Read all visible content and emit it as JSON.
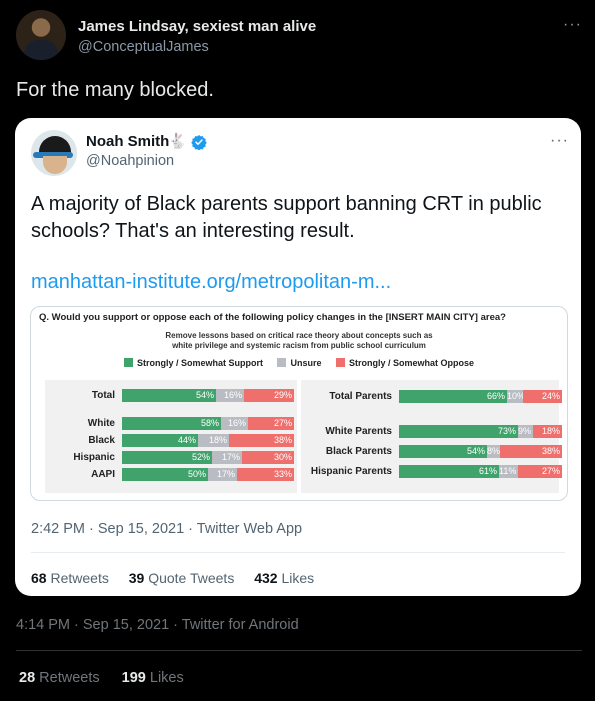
{
  "tweet": {
    "author_name": "James Lindsay, sexiest man alive",
    "author_handle": "@ConceptualJames",
    "more_icon": "more-dots-icon",
    "text": "For the many blocked.",
    "timestamp": "4:14 PM · Sep 15, 2021 · Twitter for Android",
    "retweets_count": "28",
    "retweets_label": "Retweets",
    "likes_count": "199",
    "likes_label": "Likes"
  },
  "quote": {
    "author_name": "Noah Smith",
    "rabbit_emoji": "🐇",
    "verified_icon": "verified-badge-icon",
    "author_handle": "@Noahpinion",
    "text": "A majority of Black parents support banning CRT in public schools? That's an interesting result.",
    "link": "manhattan-institute.org/metropolitan-m...",
    "timestamp": "2:42 PM · Sep 15, 2021 · Twitter Web App",
    "retweets_count": "68",
    "retweets_label": "Retweets",
    "quotes_count": "39",
    "quotes_label": "Quote Tweets",
    "likes_count": "432",
    "likes_label": "Likes"
  },
  "chart_data": {
    "type": "bar",
    "stacked": true,
    "title": "Q. Would you support or oppose each of the following policy changes in the [INSERT MAIN CITY] area?",
    "subtitle": "Remove lessons based on critical race theory about concepts such as white privilege and systemic racism from public school curriculum",
    "subtitle_line1": "Remove lessons based on critical race theory about concepts such as",
    "subtitle_line2": "white privilege and systemic racism from public school curriculum",
    "legend": [
      "Strongly / Somewhat Support",
      "Unsure",
      "Strongly / Somewhat Oppose"
    ],
    "colors": {
      "support": "#3fa36b",
      "unsure": "#b9bcc2",
      "oppose": "#ee6f6c"
    },
    "panels": [
      {
        "rows": [
          {
            "label": "Total",
            "values": [
              54,
              16,
              29
            ],
            "texts": [
              "54%",
              "16%",
              "29%"
            ]
          },
          {
            "label": "White",
            "values": [
              58,
              16,
              27
            ],
            "texts": [
              "58%",
              "16%",
              "27%"
            ]
          },
          {
            "label": "Black",
            "values": [
              44,
              18,
              38
            ],
            "texts": [
              "44%",
              "18%",
              "38%"
            ]
          },
          {
            "label": "Hispanic",
            "values": [
              52,
              17,
              30
            ],
            "texts": [
              "52%",
              "17%",
              "30%"
            ]
          },
          {
            "label": "AAPI",
            "values": [
              50,
              17,
              33
            ],
            "texts": [
              "50%",
              "17%",
              "33%"
            ]
          }
        ]
      },
      {
        "rows": [
          {
            "label": "Total Parents",
            "values": [
              66,
              10,
              24
            ],
            "texts": [
              "66%",
              "10%",
              "24%"
            ]
          },
          {
            "label": "White Parents",
            "values": [
              73,
              9,
              18
            ],
            "texts": [
              "73%",
              "9%",
              "18%"
            ]
          },
          {
            "label": "Black Parents",
            "values": [
              54,
              8,
              38
            ],
            "texts": [
              "54%",
              "8%",
              "38%"
            ]
          },
          {
            "label": "Hispanic Parents",
            "values": [
              61,
              11,
              27
            ],
            "texts": [
              "61%",
              "11%",
              "27%"
            ]
          }
        ]
      }
    ]
  }
}
